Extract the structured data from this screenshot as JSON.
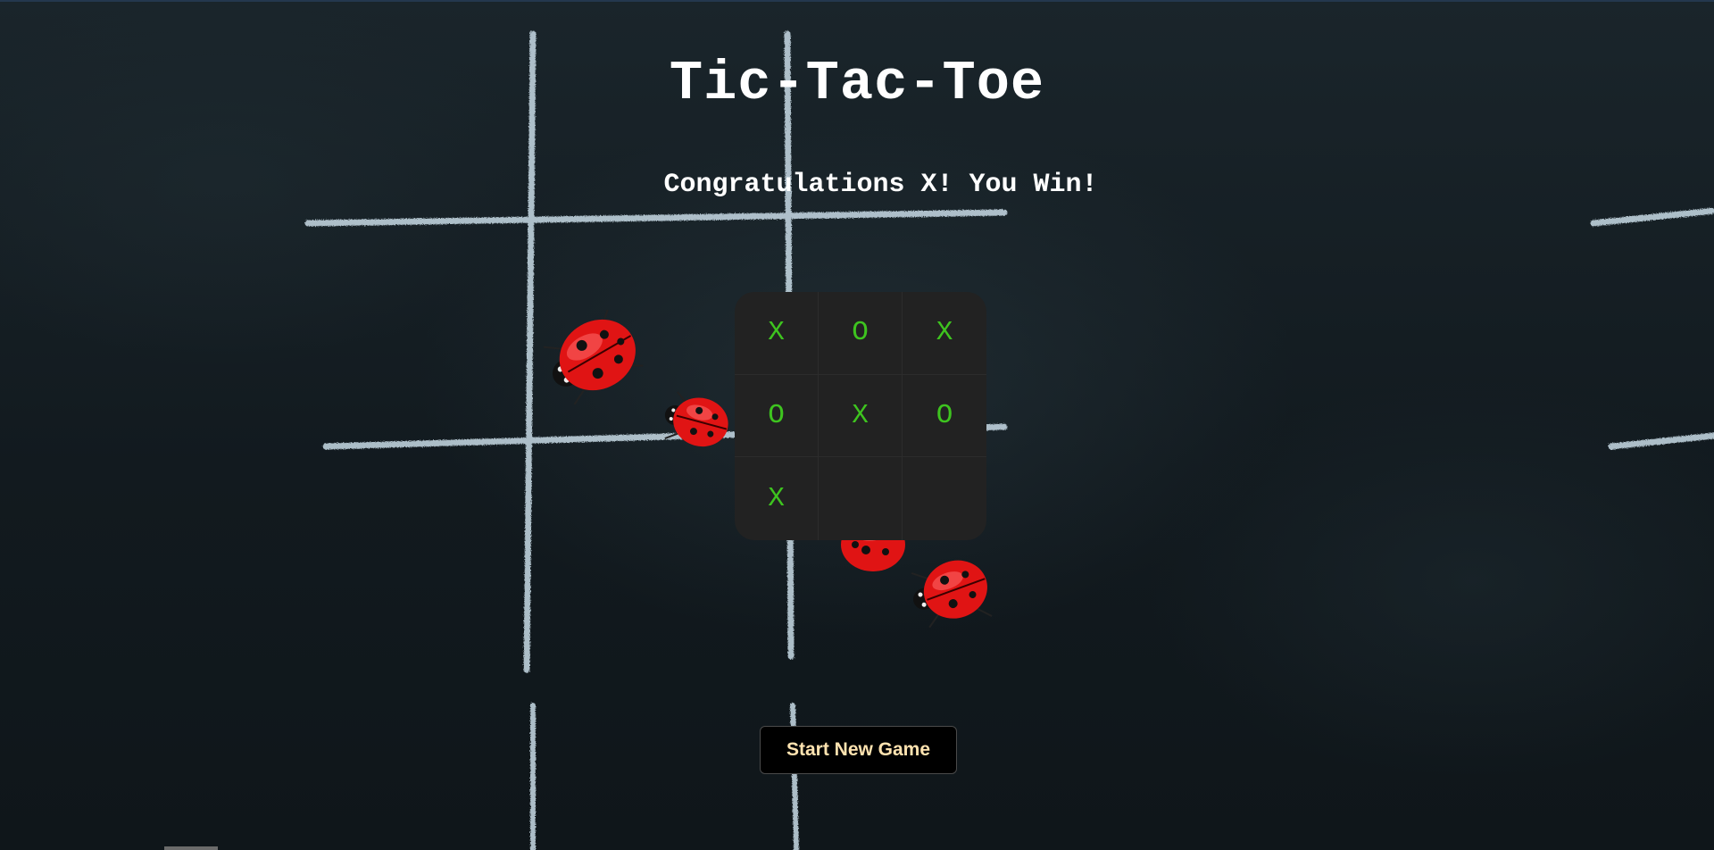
{
  "game": {
    "title": "Tic-Tac-Toe",
    "status_message": "Congratulations X! You Win!",
    "board": [
      [
        "X",
        "O",
        "X"
      ],
      [
        "O",
        "X",
        "O"
      ],
      [
        "X",
        "",
        ""
      ]
    ],
    "winner": "X",
    "new_game_label": "Start New Game"
  },
  "theme": {
    "background": "#131b20",
    "board_background": "#222222",
    "mark_color": "#3ec41f",
    "title_color": "#ffffff",
    "button_background": "#000000",
    "button_text_color": "#ffe3b0",
    "chalk_color": "#c8dbe6",
    "ladybug_color": "#e01414"
  },
  "decorations": {
    "background_art": "chalk-tic-tac-toe-grid-with-ladybugs"
  }
}
